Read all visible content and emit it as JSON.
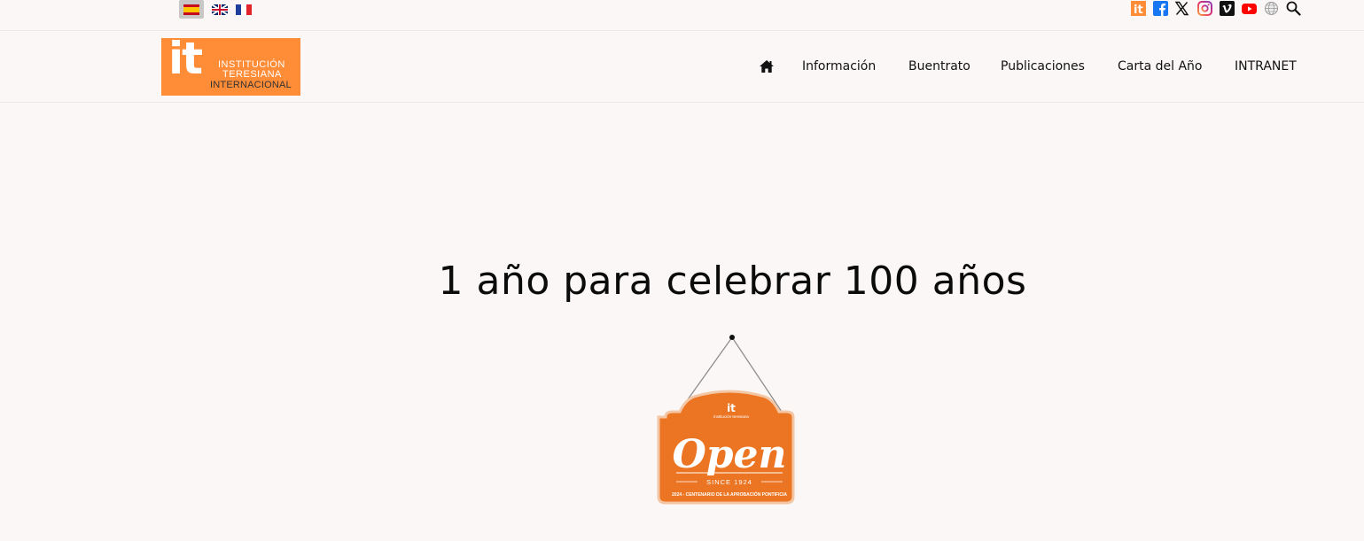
{
  "languages": [
    {
      "code": "es",
      "label": "Español",
      "active": true
    },
    {
      "code": "en",
      "label": "English",
      "active": false
    },
    {
      "code": "fr",
      "label": "Français",
      "active": false
    }
  ],
  "social_icons": [
    "it-icon",
    "facebook-icon",
    "x-icon",
    "instagram-icon",
    "vimeo-icon",
    "youtube-icon",
    "globe-icon",
    "search-icon"
  ],
  "logo": {
    "mark": "it",
    "line1": "INSTITUCIÓN",
    "line2": "TERESIANA",
    "line3": "INTERNACIONAL",
    "color": "#ff8c37"
  },
  "nav": {
    "home_icon": "home-icon",
    "items": [
      "Información",
      "Buentrato",
      "Publicaciones",
      "Carta del Año",
      "INTRANET"
    ]
  },
  "main": {
    "headline": "1 año para celebrar 100 años",
    "sign": {
      "mark": "it",
      "small": "institución teresiana",
      "word": "Open",
      "since": "SINCE 1924",
      "caption": "2024 - CENTENARIO DE LA APROBACIÓN PONTIFICIA",
      "color": "#ec7523"
    }
  },
  "colors": {
    "background": "#faf7f6",
    "accent": "#ff8c37"
  }
}
